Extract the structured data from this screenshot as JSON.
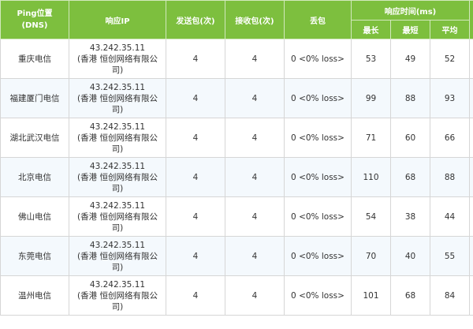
{
  "header": {
    "location_line1": "Ping位置",
    "location_line2": "(DNS)",
    "ip": "响应IP",
    "sent": "发送包(次)",
    "received": "接收包(次)",
    "loss": "丢包",
    "response_time": "响应时间(ms)",
    "max": "最长",
    "min": "最短",
    "avg": "平均"
  },
  "rows": [
    {
      "location": "重庆电信",
      "ip": "43.242.35.11",
      "ip_owner_line1": "(香港 恒创网络有限公",
      "ip_owner_line2": "司)",
      "sent": "4",
      "received": "4",
      "loss": "0 <0% loss>",
      "max": "53",
      "min": "49",
      "avg": "52"
    },
    {
      "location": "福建厦门电信",
      "ip": "43.242.35.11",
      "ip_owner_line1": "(香港 恒创网络有限公",
      "ip_owner_line2": "司)",
      "sent": "4",
      "received": "4",
      "loss": "0 <0% loss>",
      "max": "99",
      "min": "88",
      "avg": "93"
    },
    {
      "location": "湖北武汉电信",
      "ip": "43.242.35.11",
      "ip_owner_line1": "(香港 恒创网络有限公",
      "ip_owner_line2": "司)",
      "sent": "4",
      "received": "4",
      "loss": "0 <0% loss>",
      "max": "71",
      "min": "60",
      "avg": "66"
    },
    {
      "location": "北京电信",
      "ip": "43.242.35.11",
      "ip_owner_line1": "(香港 恒创网络有限公",
      "ip_owner_line2": "司)",
      "sent": "4",
      "received": "4",
      "loss": "0 <0% loss>",
      "max": "110",
      "min": "68",
      "avg": "88"
    },
    {
      "location": "佛山电信",
      "ip": "43.242.35.11",
      "ip_owner_line1": "(香港 恒创网络有限公",
      "ip_owner_line2": "司)",
      "sent": "4",
      "received": "4",
      "loss": "0 <0% loss>",
      "max": "54",
      "min": "38",
      "avg": "44"
    },
    {
      "location": "东莞电信",
      "ip": "43.242.35.11",
      "ip_owner_line1": "(香港 恒创网络有限公",
      "ip_owner_line2": "司)",
      "sent": "4",
      "received": "4",
      "loss": "0 <0% loss>",
      "max": "70",
      "min": "40",
      "avg": "55"
    },
    {
      "location": "温州电信",
      "ip": "43.242.35.11",
      "ip_owner_line1": "(香港 恒创网络有限公",
      "ip_owner_line2": "司)",
      "sent": "4",
      "received": "4",
      "loss": "0 <0% loss>",
      "max": "101",
      "min": "68",
      "avg": "84"
    }
  ],
  "colors": {
    "header_bg": "#7dbf3e",
    "header_text": "#ffffff",
    "row_alt_bg": "#f4f9fd",
    "border": "#d6d6d6"
  }
}
